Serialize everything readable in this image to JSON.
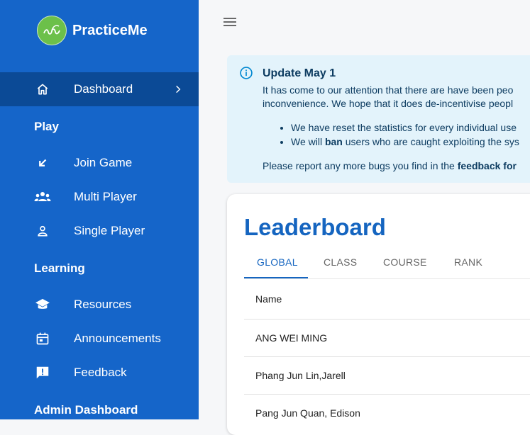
{
  "brand": {
    "name": "PracticeMe",
    "logo_icon": "seed-logo-icon"
  },
  "sidebar": {
    "dashboard": {
      "label": "Dashboard",
      "icon": "home-icon"
    },
    "play_title": "Play",
    "play_items": [
      {
        "label": "Join Game",
        "icon": "arrow-down-left-icon"
      },
      {
        "label": "Multi Player",
        "icon": "group-icon"
      },
      {
        "label": "Single Player",
        "icon": "person-icon"
      }
    ],
    "learning_title": "Learning",
    "learning_items": [
      {
        "label": "Resources",
        "icon": "school-icon"
      },
      {
        "label": "Announcements",
        "icon": "calendar-icon"
      },
      {
        "label": "Feedback",
        "icon": "feedback-icon"
      }
    ],
    "admin_title": "Admin Dashboard"
  },
  "alert": {
    "title": "Update May 1",
    "line1": "It has come to our attention that there are have been peo",
    "line2": "inconvenience. We hope that it does de-incentivise peopl",
    "bullet1": "We have reset the statistics for every individual use",
    "bullet2_prefix": "We will ",
    "bullet2_bold": "ban",
    "bullet2_suffix": " users who are caught exploiting the sys",
    "footer_prefix": "Please report any more bugs you find in the ",
    "footer_bold": "feedback for"
  },
  "leaderboard": {
    "title": "Leaderboard",
    "tabs": [
      "GLOBAL",
      "CLASS",
      "COURSE",
      "RANK"
    ],
    "active_tab": "GLOBAL",
    "column_name": "Name",
    "rows": [
      "ANG WEI MING",
      "Phang Jun Lin,Jarell",
      "Pang Jun Quan, Edison"
    ]
  },
  "colors": {
    "sidebar": "#1565c9",
    "active": "#0b4a96",
    "accent": "#1565c0",
    "alert_bg": "#e3f3fb"
  }
}
